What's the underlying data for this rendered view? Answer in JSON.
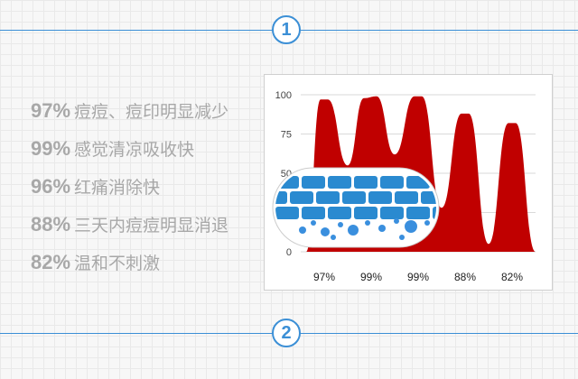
{
  "steps": [
    {
      "number": "1"
    },
    {
      "number": "2"
    }
  ],
  "stats": [
    {
      "pct": "97%",
      "text": "痘痘、痘印明显减少"
    },
    {
      "pct": "99%",
      "text": "感觉清凉吸收快"
    },
    {
      "pct": "96%",
      "text": "红痛消除快"
    },
    {
      "pct": "88%",
      "text": "三天内痘痘明显消退"
    },
    {
      "pct": "82%",
      "text": "温和不刺激"
    }
  ],
  "colors": {
    "accent": "#3b8fd6",
    "area": "#c00000",
    "pore_blue": "#2a8ad0"
  },
  "chart_data": {
    "type": "area",
    "categories": [
      "97%",
      "99%",
      "99%",
      "88%",
      "82%"
    ],
    "values": [
      97,
      99,
      99,
      88,
      82
    ],
    "ylim": [
      0,
      100
    ],
    "yticks": [
      "0",
      "25",
      "50",
      "75",
      "100"
    ],
    "grid": true,
    "title": "",
    "xlabel": "",
    "ylabel": ""
  },
  "illustration": {
    "name": "skin-pore-icon"
  }
}
